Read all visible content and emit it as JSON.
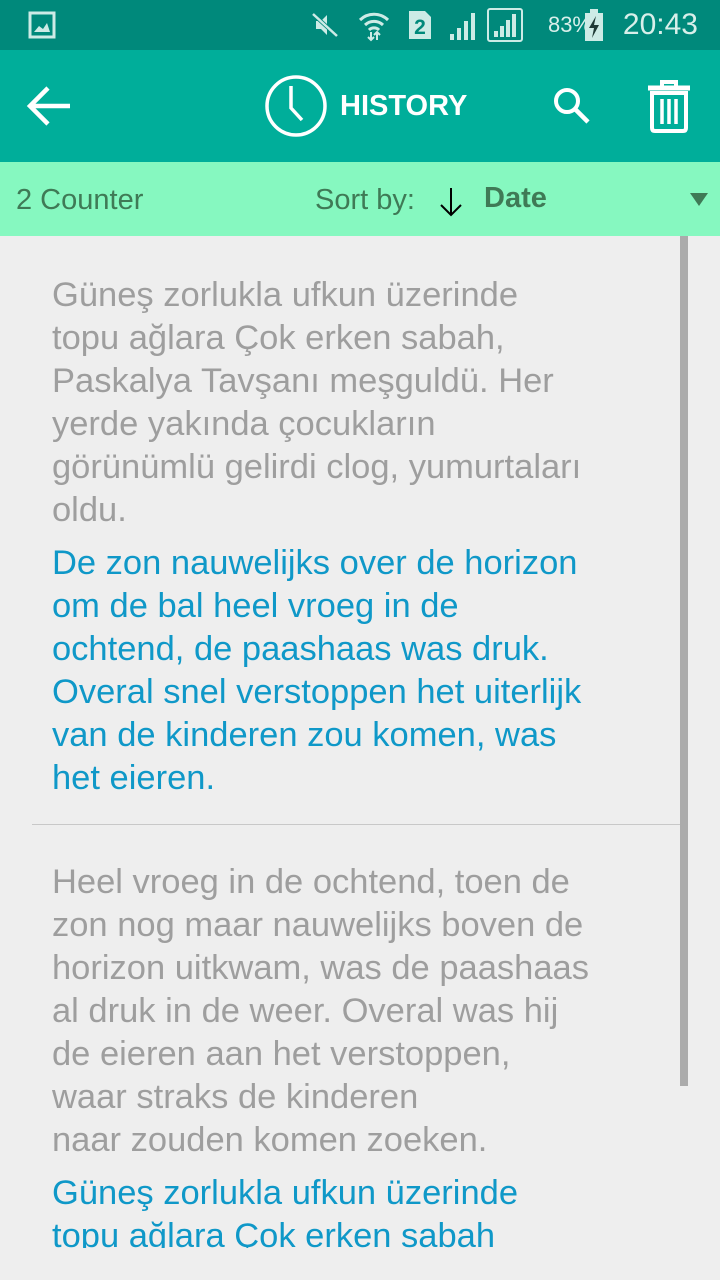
{
  "status_bar": {
    "notification_icon": "image-icon",
    "icons": [
      "mute-icon",
      "wifi-icon",
      "sim2-icon",
      "signal-icon",
      "signal-icon-2"
    ],
    "sim_label": "2",
    "battery_percent": "83%",
    "battery_icon": "battery-charging-icon",
    "time": "20:43"
  },
  "app_bar": {
    "back_icon": "arrow-left-icon",
    "title_icon": "clock-icon",
    "title": "HISTORY",
    "search_icon": "search-icon",
    "delete_icon": "trash-icon"
  },
  "sort_bar": {
    "counter": "2 Counter",
    "sort_label": "Sort by:",
    "sort_direction_icon": "arrow-down-icon",
    "sort_value": "Date",
    "dropdown_icon": "triangle-down-icon"
  },
  "colors": {
    "status_bar": "#00897B",
    "app_bar": "#00AE9A",
    "sort_bar": "#86F8C0",
    "sort_text": "#3F7A56",
    "source_text": "#9E9E9E",
    "translation_text": "#0F98C8",
    "background": "#EEEEEE"
  },
  "history": [
    {
      "source": "Güneş zorlukla ufkun üzerinde\ntopu ağlara Çok erken sabah,\nPaskalya Tavşanı meşguldü. Her\nyerde yakında çocukların\ngörünümlü gelirdi clog, yumurtaları\noldu.",
      "translation": "De zon nauwelijks over de horizon\nom de bal heel vroeg in de\nochtend, de paashaas was druk.\nOveral snel verstoppen het uiterlijk\nvan de kinderen zou komen, was\nhet eieren."
    },
    {
      "source": "Heel vroeg in de ochtend, toen de\nzon nog maar nauwelijks boven de\nhorizon uitkwam, was de paashaas\nal druk in de weer. Overal was hij\nde eieren aan het verstoppen,\nwaar straks de kinderen\nnaar zouden komen zoeken.",
      "translation": "Güneş zorlukla ufkun üzerinde\ntopu ağlara Çok erken sabah"
    }
  ]
}
